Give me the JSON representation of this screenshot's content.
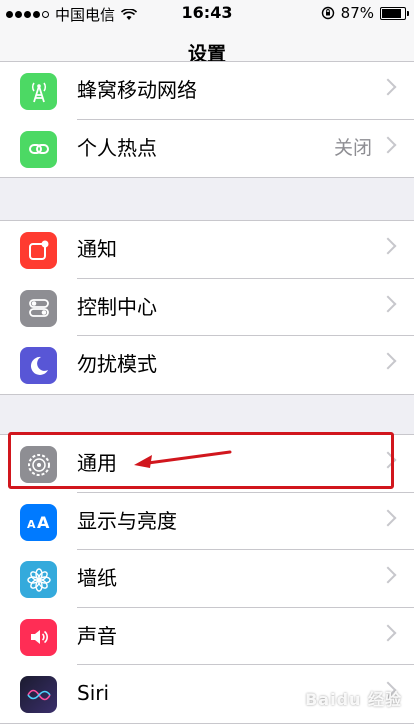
{
  "status_bar": {
    "carrier": "中国电信",
    "time": "16:43",
    "battery": "87%",
    "battery_level": 0.87
  },
  "nav": {
    "title": "设置"
  },
  "groups": [
    {
      "items": [
        {
          "label": "蜂窝移动网络",
          "value": "",
          "icon": "antenna-icon",
          "color": "#4cd964"
        },
        {
          "label": "个人热点",
          "value": "关闭",
          "icon": "hotspot-icon",
          "color": "#4cd964"
        }
      ]
    },
    {
      "items": [
        {
          "label": "通知",
          "value": "",
          "icon": "notifications-icon",
          "color": "#ff3b30"
        },
        {
          "label": "控制中心",
          "value": "",
          "icon": "control-center-icon",
          "color": "#8e8e93"
        },
        {
          "label": "勿扰模式",
          "value": "",
          "icon": "moon-icon",
          "color": "#5856d6"
        }
      ]
    },
    {
      "items": [
        {
          "label": "通用",
          "value": "",
          "icon": "gear-icon",
          "color": "#8e8e93"
        },
        {
          "label": "显示与亮度",
          "value": "",
          "icon": "display-brightness-icon",
          "color": "#007aff"
        },
        {
          "label": "墙纸",
          "value": "",
          "icon": "wallpaper-flower-icon",
          "color": "#34aadc"
        },
        {
          "label": "声音",
          "value": "",
          "icon": "speaker-icon",
          "color": "#ff2d55"
        },
        {
          "label": "Siri",
          "value": "",
          "icon": "siri-icon",
          "color": "#1b1b2f"
        }
      ]
    }
  ],
  "watermark": "Baidu 经验"
}
